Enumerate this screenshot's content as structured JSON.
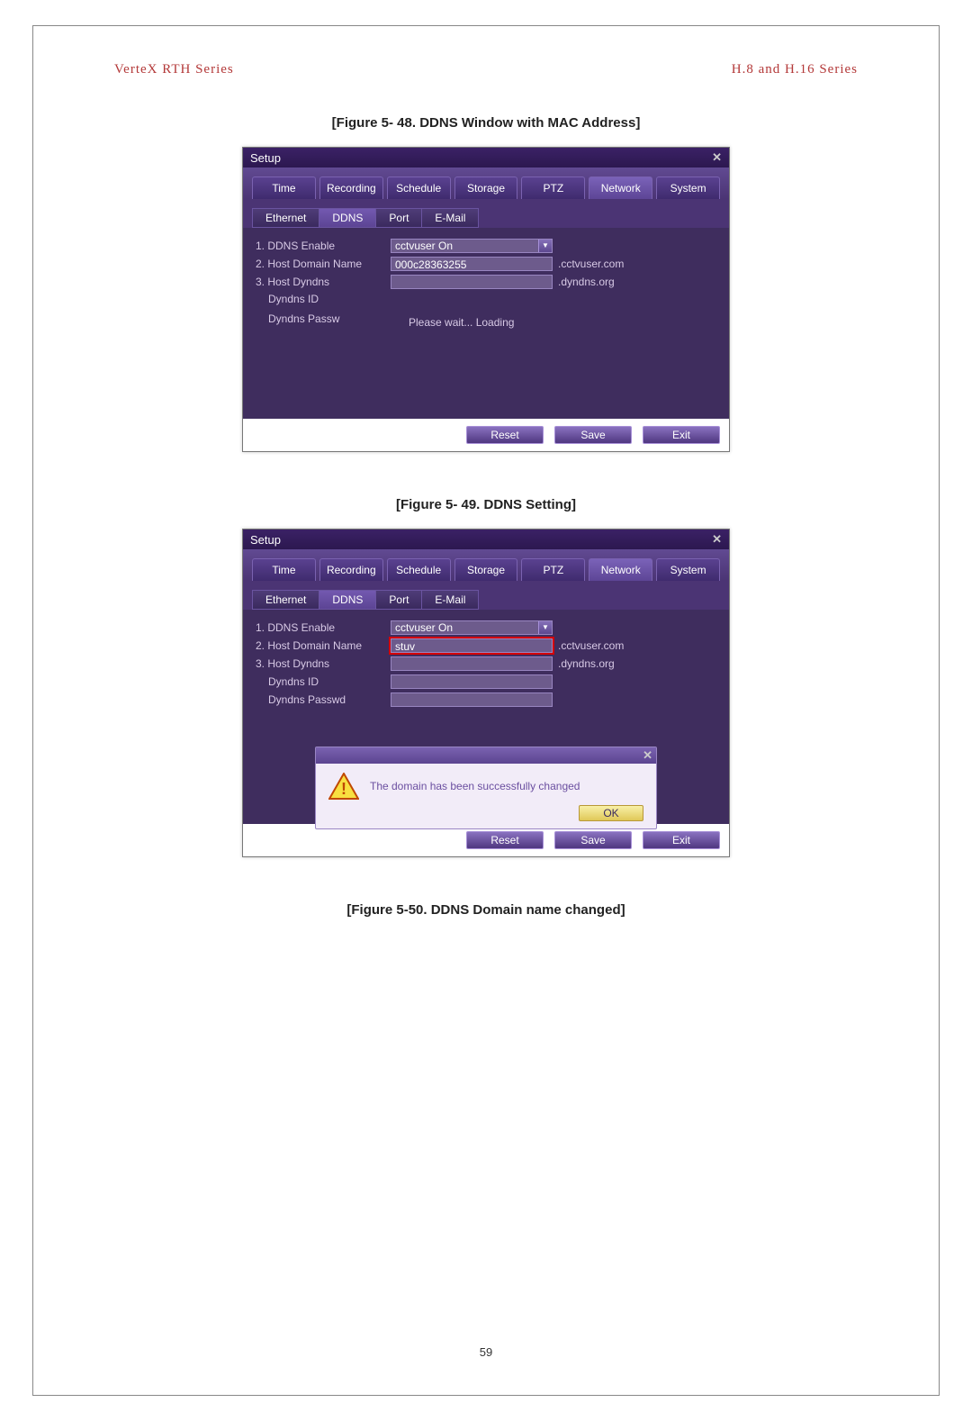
{
  "header": {
    "left": "VerteX RTH Series",
    "right": "H.8 and H.16 Series"
  },
  "captions": {
    "fig48": "[Figure 5- 48. DDNS Window with MAC Address]",
    "fig49": "[Figure 5- 49. DDNS Setting]",
    "fig50": "[Figure 5-50. DDNS Domain name changed]"
  },
  "page_number": "59",
  "window": {
    "title": "Setup",
    "main_tabs": [
      "Time",
      "Recording",
      "Schedule",
      "Storage",
      "PTZ",
      "Network",
      "System"
    ],
    "active_main_tab": "Network",
    "sub_tabs": [
      "Ethernet",
      "DDNS",
      "Port",
      "E-Mail"
    ],
    "active_sub_tab": "DDNS",
    "labels": {
      "ddns_enable": "1. DDNS Enable",
      "host_domain": "2. Host Domain Name",
      "host_dyndns": "3. Host Dyndns",
      "dyndns_id": "Dyndns ID",
      "dyndns_pw_short": "Dyndns Passw",
      "dyndns_pw": "Dyndns Passwd"
    },
    "suffix": {
      "cctvuser": ".cctvuser.com",
      "dyndns": ".dyndns.org"
    },
    "buttons": {
      "reset": "Reset",
      "save": "Save",
      "exit": "Exit"
    }
  },
  "fig48_values": {
    "ddns_enable": "cctvuser On",
    "host_domain": "000c28363255",
    "loading": "Please wait... Loading"
  },
  "fig49_values": {
    "ddns_enable": "cctvuser On",
    "host_domain": "stuv",
    "popup_msg": "The domain has been successfully changed",
    "ok": "OK"
  }
}
